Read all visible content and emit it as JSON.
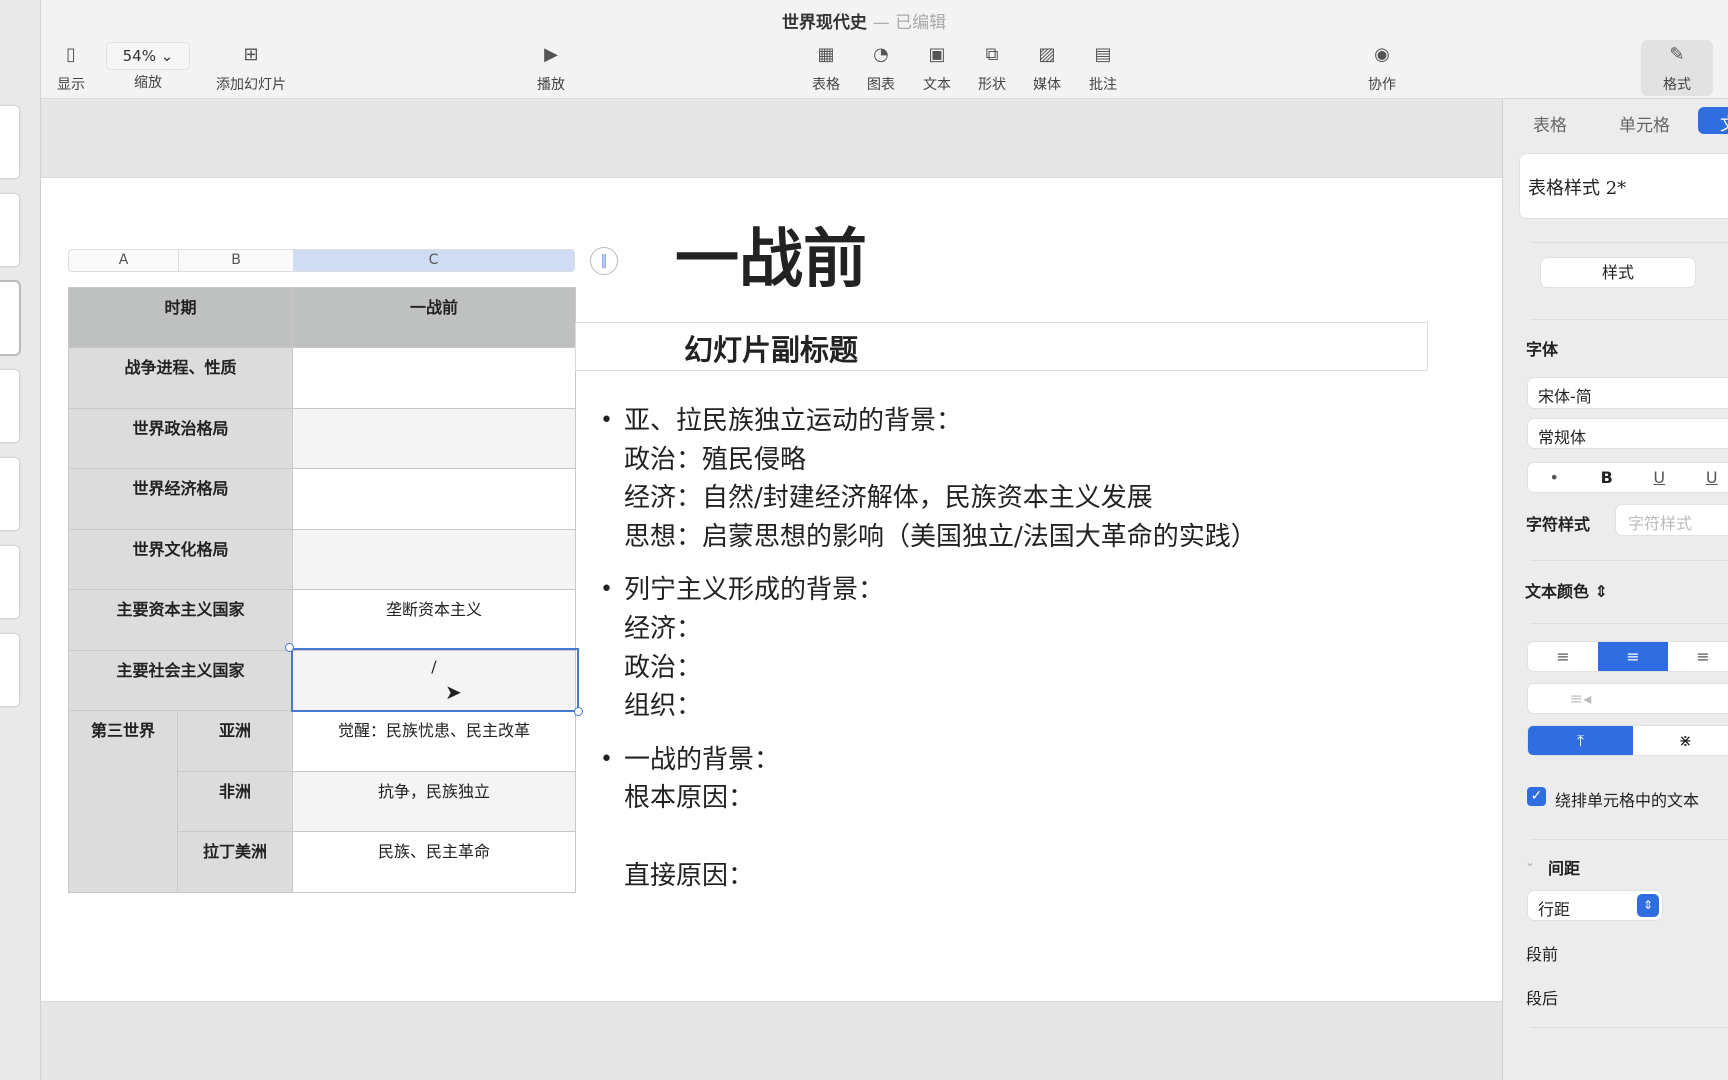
{
  "window": {
    "doc_title": "世界现代史",
    "status": "— 已编辑"
  },
  "toolbar": {
    "view": "显示",
    "zoom_value": "54%",
    "zoom": "缩放",
    "add_slide": "添加幻灯片",
    "play": "播放",
    "table": "表格",
    "chart": "图表",
    "text": "文本",
    "shape": "形状",
    "media": "媒体",
    "comment": "批注",
    "collaborate": "协作",
    "format": "格式"
  },
  "table": {
    "columns": [
      "A",
      "B",
      "C"
    ],
    "header": [
      "时期",
      "一战前"
    ],
    "rows": [
      {
        "label": "战争进程、性质",
        "value": ""
      },
      {
        "label": "世界政治格局",
        "value": ""
      },
      {
        "label": "世界经济格局",
        "value": ""
      },
      {
        "label": "世界文化格局",
        "value": ""
      },
      {
        "label": "主要资本主义国家",
        "value": "垄断资本主义"
      },
      {
        "label": "主要社会主义国家",
        "value": "/"
      }
    ],
    "third_world": {
      "label": "第三世界",
      "rows": [
        {
          "label": "亚洲",
          "value": "觉醒：民族忧患、民主改革"
        },
        {
          "label": "非洲",
          "value": "抗争，民族独立"
        },
        {
          "label": "拉丁美洲",
          "value": "民族、民主革命"
        }
      ]
    }
  },
  "slide": {
    "title": "一战前",
    "subtitle": "幻灯片副标题",
    "bullets": [
      {
        "lines": [
          "亚、拉民族独立运动的背景：",
          "政治：殖民侵略",
          "经济：自然/封建经济解体，民族资本主义发展",
          "思想：启蒙思想的影响（美国独立/法国大革命的实践）"
        ]
      },
      {
        "lines": [
          "列宁主义形成的背景：",
          "经济：",
          "政治：",
          "组织："
        ]
      },
      {
        "lines": [
          "一战的背景：",
          "根本原因：",
          "",
          "直接原因："
        ]
      }
    ]
  },
  "panel": {
    "tabs": [
      "表格",
      "单元格",
      "文"
    ],
    "style_name": "表格样式 2*",
    "style_btn": "样式",
    "font_label": "字体",
    "font_family": "宋体-简",
    "font_weight": "常规体",
    "char_style_label": "字符样式",
    "char_style_placeholder": "字符样式",
    "text_color_label": "文本颜色",
    "wrap_label": "绕排单元格中的文本",
    "wrap_checked": true,
    "spacing_label": "间距",
    "line_spacing": "行距",
    "before": "段前",
    "after": "段后",
    "accent": "#2f6de1"
  }
}
